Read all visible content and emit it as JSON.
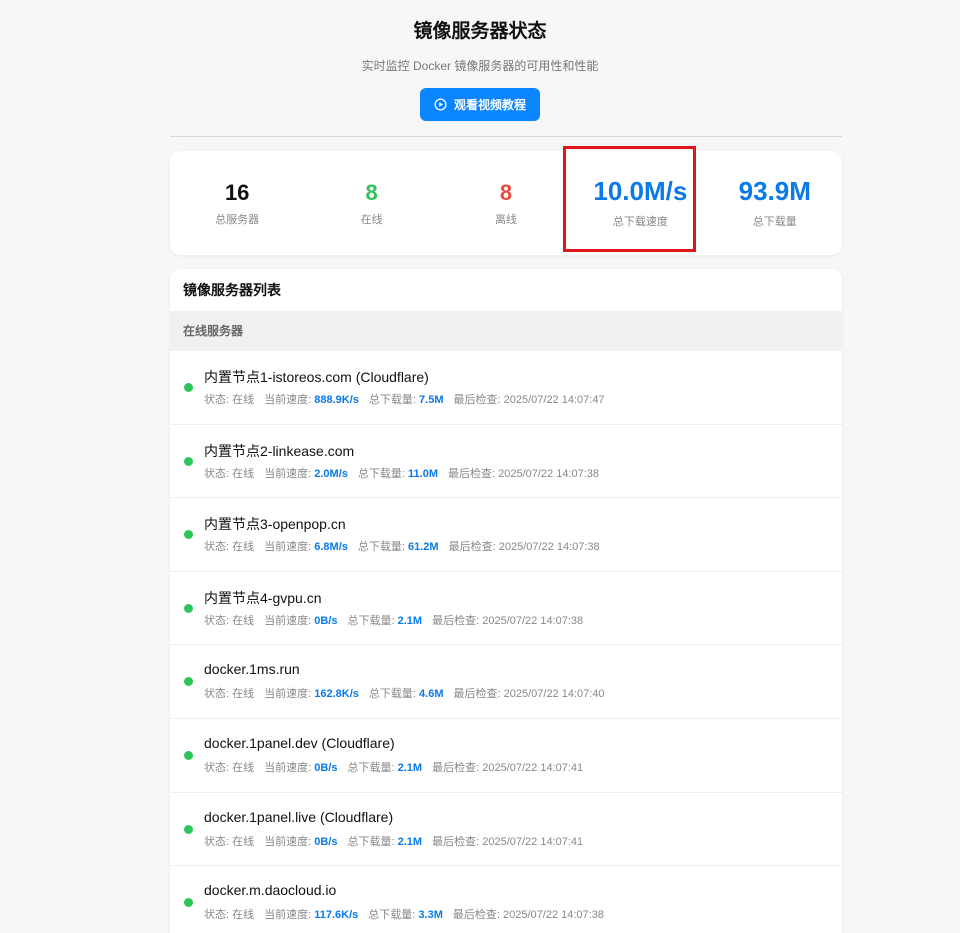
{
  "header": {
    "title": "镜像服务器状态",
    "subtitle": "实时监控 Docker 镜像服务器的可用性和性能",
    "video_button": "观看视频教程"
  },
  "stats": {
    "total_servers": {
      "value": "16",
      "label": "总服务器"
    },
    "online": {
      "value": "8",
      "label": "在线"
    },
    "offline": {
      "value": "8",
      "label": "离线"
    },
    "total_speed": {
      "value": "10.0M/s",
      "label": "总下载速度"
    },
    "total_download": {
      "value": "93.9M",
      "label": "总下载量"
    }
  },
  "list": {
    "title": "镜像服务器列表",
    "section": "在线服务器",
    "labels": {
      "status": "状态: ",
      "speed": "当前速度: ",
      "total": "总下载量: ",
      "checked": "最后检查: "
    },
    "servers": [
      {
        "name": "内置节点1-istoreos.com (Cloudflare)",
        "status": "在线",
        "speed": "888.9K/s",
        "total": "7.5M",
        "checked": "2025/07/22 14:07:47"
      },
      {
        "name": "内置节点2-linkease.com",
        "status": "在线",
        "speed": "2.0M/s",
        "total": "11.0M",
        "checked": "2025/07/22 14:07:38"
      },
      {
        "name": "内置节点3-openpop.cn",
        "status": "在线",
        "speed": "6.8M/s",
        "total": "61.2M",
        "checked": "2025/07/22 14:07:38"
      },
      {
        "name": "内置节点4-gvpu.cn",
        "status": "在线",
        "speed": "0B/s",
        "total": "2.1M",
        "checked": "2025/07/22 14:07:38"
      },
      {
        "name": "docker.1ms.run",
        "status": "在线",
        "speed": "162.8K/s",
        "total": "4.6M",
        "checked": "2025/07/22 14:07:40"
      },
      {
        "name": "docker.1panel.dev (Cloudflare)",
        "status": "在线",
        "speed": "0B/s",
        "total": "2.1M",
        "checked": "2025/07/22 14:07:41"
      },
      {
        "name": "docker.1panel.live (Cloudflare)",
        "status": "在线",
        "speed": "0B/s",
        "total": "2.1M",
        "checked": "2025/07/22 14:07:41"
      },
      {
        "name": "docker.m.daocloud.io",
        "status": "在线",
        "speed": "117.6K/s",
        "total": "3.3M",
        "checked": "2025/07/22 14:07:38"
      }
    ]
  },
  "colors": {
    "accent": "#0a84ff",
    "online": "#2fc45b",
    "offline": "#e94b3c",
    "highlight_box": "#e0161a"
  }
}
